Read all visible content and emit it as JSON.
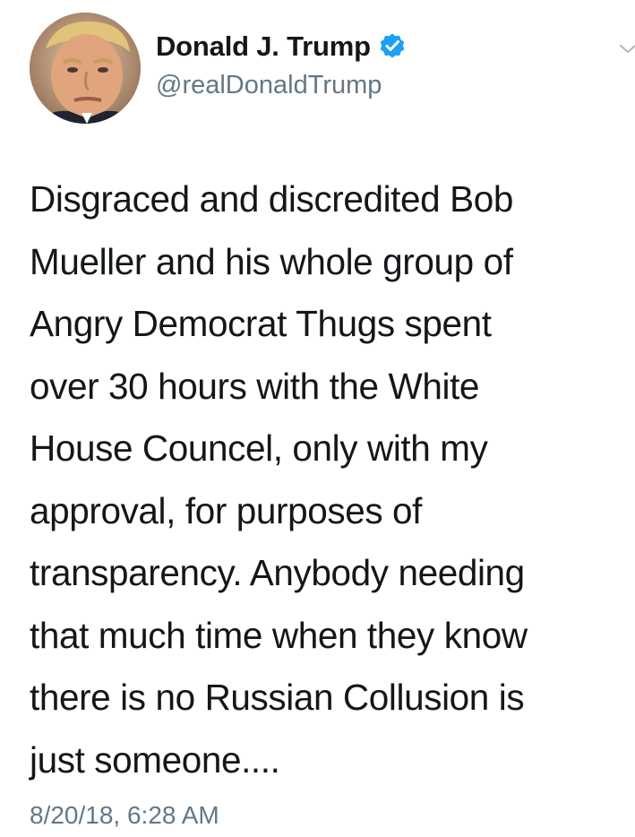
{
  "user": {
    "display_name": "Donald J. Trump",
    "handle": "@realDonaldTrump",
    "verified": true,
    "avatar_icon": "profile-photo",
    "verified_icon": "verified-badge-icon",
    "menu_icon": "chevron-down-icon"
  },
  "tweet": {
    "lines": [
      "Disgraced and discredited Bob",
      "Mueller and his whole group of",
      "Angry Democrat Thugs spent",
      "over 30 hours with the White",
      "House Councel, only with my",
      "approval, for purposes of",
      "transparency. Anybody needing",
      "that much time when they know",
      "there is no Russian Collusion is",
      "just someone...."
    ],
    "timestamp": "8/20/18, 6:28 AM"
  },
  "colors": {
    "text": "#14171a",
    "secondary": "#657786",
    "verified_blue": "#1da1f2",
    "background": "#ffffff"
  }
}
